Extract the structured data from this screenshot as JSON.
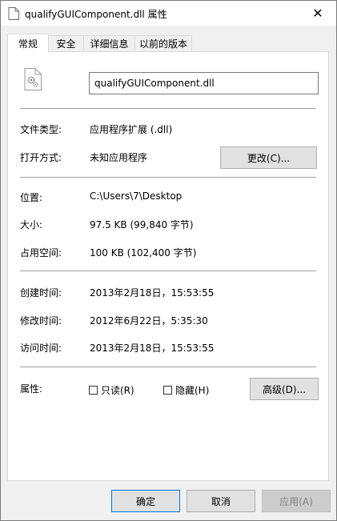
{
  "window": {
    "title": "qualifyGUIComponent.dll 属性",
    "close_glyph": "✕"
  },
  "tabs": [
    {
      "label": "常规",
      "active": true
    },
    {
      "label": "安全",
      "active": false
    },
    {
      "label": "详细信息",
      "active": false
    },
    {
      "label": "以前的版本",
      "active": false
    }
  ],
  "general": {
    "file_name": "qualifyGUIComponent.dll",
    "file_type_label": "文件类型:",
    "file_type_value": "应用程序扩展 (.dll)",
    "open_with_label": "打开方式:",
    "open_with_value": "未知应用程序",
    "change_button": "更改(C)...",
    "location_label": "位置:",
    "location_value": "C:\\Users\\7\\Desktop",
    "size_label": "大小:",
    "size_value": "97.5 KB (99,840 字节)",
    "size_on_disk_label": "占用空间:",
    "size_on_disk_value": "100 KB (102,400 字节)",
    "created_label": "创建时间:",
    "created_value": "2013年2月18日，15:53:55",
    "modified_label": "修改时间:",
    "modified_value": "2012年6月22日，5:35:30",
    "accessed_label": "访问时间:",
    "accessed_value": "2013年2月18日，15:53:55",
    "attributes_label": "属性:",
    "readonly_label": "只读(R)",
    "readonly_checked": false,
    "hidden_label": "隐藏(H)",
    "hidden_checked": false,
    "advanced_button": "高级(D)..."
  },
  "footer": {
    "ok_button": "确定",
    "cancel_button": "取消",
    "apply_button": "应用(A)"
  },
  "colors": {
    "accent": "#0078d7",
    "button_face": "#e1e1e1",
    "disabled_text": "#838383"
  }
}
